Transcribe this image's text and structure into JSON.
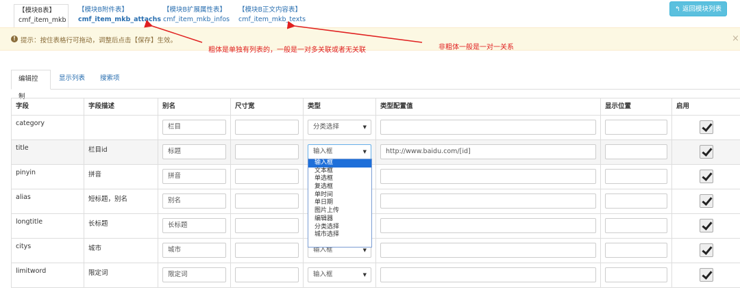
{
  "top_tabs": [
    {
      "line1": "【模块B表】",
      "line2": "cmf_item_mkb"
    },
    {
      "line1": "【模块B附件表】",
      "line2": "cmf_item_mkb_attachs"
    },
    {
      "line1": "【模块B扩展属性表】",
      "line2": "cmf_item_mkb_infos"
    },
    {
      "line1": "【模块B正文内容表】",
      "line2": "cmf_item_mkb_texts"
    }
  ],
  "back_button": "返回模块列表",
  "alert": {
    "text": "提示：按住表格行可拖动，调整后点击【保存】生效。",
    "close": "×"
  },
  "annotations": {
    "bold": "粗体是单独有列表的，一般是一对多关联或者无关联",
    "nonbold": "非粗体一般是一对一关系"
  },
  "sub_tabs": [
    "编辑控制",
    "显示列表",
    "搜索项"
  ],
  "table": {
    "headers": [
      "字段",
      "字段描述",
      "别名",
      "尺寸宽",
      "类型",
      "类型配置值",
      "显示位置",
      "启用"
    ],
    "rows": [
      {
        "field": "category",
        "desc": "",
        "alias": "栏目",
        "type": "分类选择",
        "config": ""
      },
      {
        "field": "title",
        "desc": "栏目id",
        "alias": "标题",
        "type": "输入框",
        "config": "http://www.baidu.com/[id]"
      },
      {
        "field": "pinyin",
        "desc": "拼音",
        "alias": "拼音",
        "type": "",
        "config": ""
      },
      {
        "field": "alias",
        "desc": "短标题，别名",
        "alias": "别名",
        "type": "",
        "config": ""
      },
      {
        "field": "longtitle",
        "desc": "长标题",
        "alias": "长标题",
        "type": "",
        "config": ""
      },
      {
        "field": "citys",
        "desc": "城市",
        "alias": "城市",
        "type": "输入框",
        "config": ""
      },
      {
        "field": "limitword",
        "desc": "限定词",
        "alias": "限定词",
        "type": "输入框",
        "config": ""
      }
    ]
  },
  "dropdown_options": [
    "输入框",
    "文本框",
    "单选框",
    "复选框",
    "单时间",
    "单日期",
    "图片上传",
    "编辑器",
    "分类选择",
    "城市选择"
  ]
}
